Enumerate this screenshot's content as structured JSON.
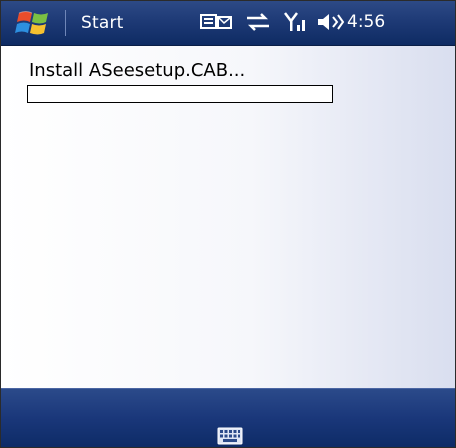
{
  "titlebar": {
    "start_label": "Start",
    "clock": "4:56",
    "icons": [
      "windows-logo",
      "notification-icon",
      "connectivity-icon",
      "signal-icon",
      "volume-icon"
    ]
  },
  "content": {
    "install_text": "Install ASeesetup.CAB...",
    "progress_fraction": 0.0
  },
  "bottombar": {
    "icons": [
      "keyboard-icon"
    ]
  },
  "colors": {
    "titlebar": "#1e3a76",
    "bottombar": "#1a377a",
    "progress_fill": "#2f5aa6",
    "background_right": "#d9deef"
  }
}
